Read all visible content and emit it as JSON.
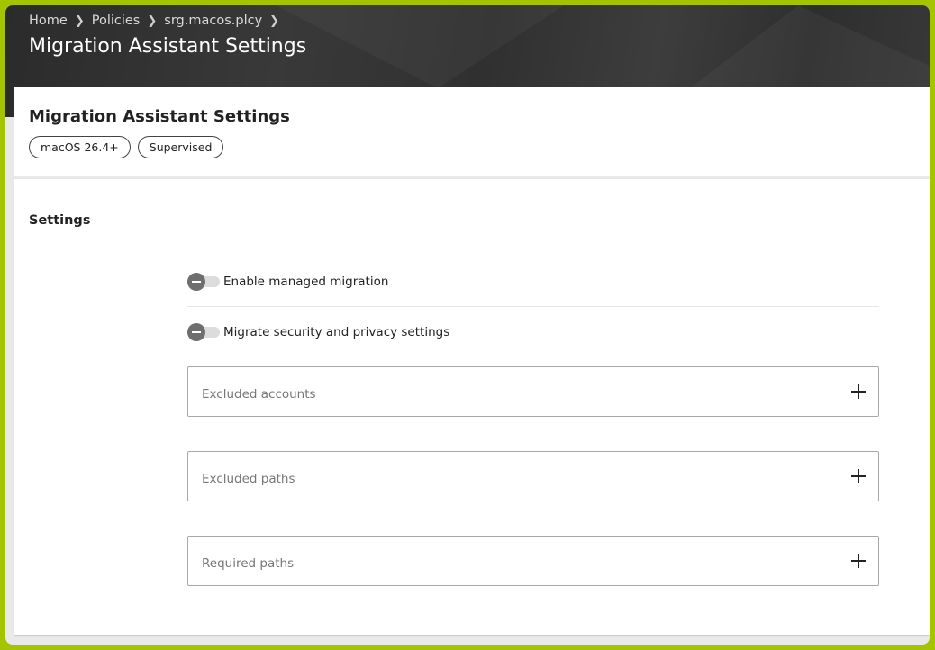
{
  "header": {
    "breadcrumb": [
      "Home",
      "Policies",
      "srg.macos.plcy"
    ],
    "title": "Migration Assistant Settings"
  },
  "card": {
    "title": "Migration Assistant Settings",
    "tags": [
      "macOS 26.4+",
      "Supervised"
    ]
  },
  "settings": {
    "section_title": "Settings",
    "toggles": [
      {
        "label": "Enable managed migration",
        "state": "off"
      },
      {
        "label": "Migrate security and privacy settings",
        "state": "off"
      }
    ],
    "lists": [
      {
        "placeholder": "Excluded accounts",
        "icon": "plus-icon"
      },
      {
        "placeholder": "Excluded paths",
        "icon": "plus-icon"
      },
      {
        "placeholder": "Required paths",
        "icon": "plus-icon"
      }
    ]
  },
  "colors": {
    "frame_border": "#a4c400",
    "header_background": "#333333",
    "toggle_knob": "#6e6e6e"
  }
}
